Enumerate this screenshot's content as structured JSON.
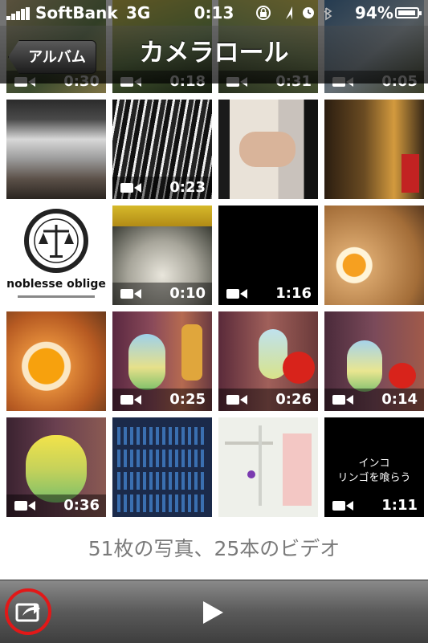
{
  "status_bar": {
    "carrier": "SoftBank",
    "network": "3G",
    "time": "0:13",
    "battery_percent": "94%",
    "battery_level": 0.94,
    "icons": [
      "orientation-lock-icon",
      "location-arrow-icon",
      "alarm-clock-icon",
      "bluetooth-icon"
    ]
  },
  "nav": {
    "back_label": "アルバム",
    "title": "カメラロール"
  },
  "thumbnails": [
    {
      "duration": "0:30"
    },
    {
      "duration": "0:18"
    },
    {
      "duration": "0:31"
    },
    {
      "duration": "0:05"
    },
    {
      "duration": ""
    },
    {
      "duration": "0:23"
    },
    {
      "duration": ""
    },
    {
      "duration": ""
    },
    {
      "duration": "",
      "text": [
        "noblesse oblige"
      ]
    },
    {
      "duration": "0:10"
    },
    {
      "duration": "1:16"
    },
    {
      "duration": ""
    },
    {
      "duration": ""
    },
    {
      "duration": "0:25"
    },
    {
      "duration": "0:26"
    },
    {
      "duration": "0:14"
    },
    {
      "duration": "0:36"
    },
    {
      "duration": ""
    },
    {
      "duration": ""
    },
    {
      "duration": "1:11",
      "text": [
        "インコ",
        "リンゴを喰らう"
      ]
    }
  ],
  "summary": "51枚の写真、25本のビデオ",
  "toolbar": {
    "share_icon": "share-icon",
    "play_icon": "play-icon",
    "highlight_color": "#e21818"
  }
}
